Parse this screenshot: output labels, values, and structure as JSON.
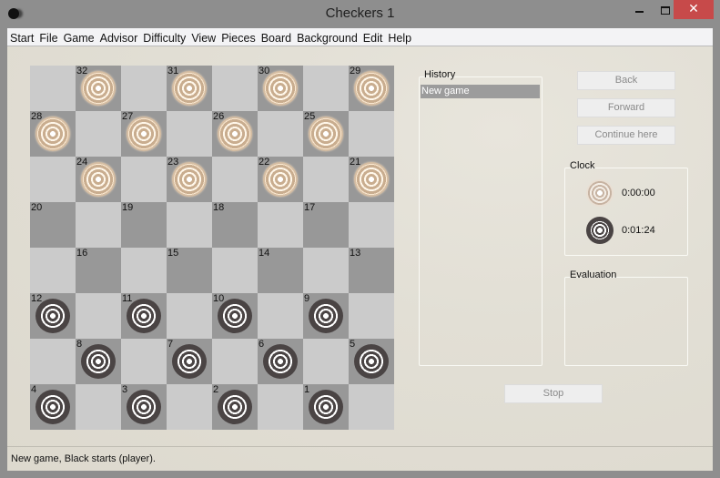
{
  "window": {
    "title": "Checkers 1",
    "close_glyph": "✕"
  },
  "menu": [
    "Start",
    "File",
    "Game",
    "Advisor",
    "Difficulty",
    "View",
    "Pieces",
    "Board",
    "Background",
    "Edit",
    "Help"
  ],
  "board": {
    "size": 8,
    "squares": [
      {
        "row": 0,
        "col": 1,
        "num": "32",
        "piece": "white"
      },
      {
        "row": 0,
        "col": 3,
        "num": "31",
        "piece": "white"
      },
      {
        "row": 0,
        "col": 5,
        "num": "30",
        "piece": "white"
      },
      {
        "row": 0,
        "col": 7,
        "num": "29",
        "piece": "white"
      },
      {
        "row": 1,
        "col": 0,
        "num": "28",
        "piece": "white"
      },
      {
        "row": 1,
        "col": 2,
        "num": "27",
        "piece": "white"
      },
      {
        "row": 1,
        "col": 4,
        "num": "26",
        "piece": "white"
      },
      {
        "row": 1,
        "col": 6,
        "num": "25",
        "piece": "white"
      },
      {
        "row": 2,
        "col": 1,
        "num": "24",
        "piece": "white"
      },
      {
        "row": 2,
        "col": 3,
        "num": "23",
        "piece": "white"
      },
      {
        "row": 2,
        "col": 5,
        "num": "22",
        "piece": "white"
      },
      {
        "row": 2,
        "col": 7,
        "num": "21",
        "piece": "white"
      },
      {
        "row": 3,
        "col": 0,
        "num": "20",
        "piece": null
      },
      {
        "row": 3,
        "col": 2,
        "num": "19",
        "piece": null
      },
      {
        "row": 3,
        "col": 4,
        "num": "18",
        "piece": null
      },
      {
        "row": 3,
        "col": 6,
        "num": "17",
        "piece": null
      },
      {
        "row": 4,
        "col": 1,
        "num": "16",
        "piece": null
      },
      {
        "row": 4,
        "col": 3,
        "num": "15",
        "piece": null
      },
      {
        "row": 4,
        "col": 5,
        "num": "14",
        "piece": null
      },
      {
        "row": 4,
        "col": 7,
        "num": "13",
        "piece": null
      },
      {
        "row": 5,
        "col": 0,
        "num": "12",
        "piece": "black"
      },
      {
        "row": 5,
        "col": 2,
        "num": "11",
        "piece": "black"
      },
      {
        "row": 5,
        "col": 4,
        "num": "10",
        "piece": "black"
      },
      {
        "row": 5,
        "col": 6,
        "num": "9",
        "piece": "black"
      },
      {
        "row": 6,
        "col": 1,
        "num": "8",
        "piece": "black"
      },
      {
        "row": 6,
        "col": 3,
        "num": "7",
        "piece": "black"
      },
      {
        "row": 6,
        "col": 5,
        "num": "6",
        "piece": "black"
      },
      {
        "row": 6,
        "col": 7,
        "num": "5",
        "piece": "black"
      },
      {
        "row": 7,
        "col": 0,
        "num": "4",
        "piece": "black"
      },
      {
        "row": 7,
        "col": 2,
        "num": "3",
        "piece": "black"
      },
      {
        "row": 7,
        "col": 4,
        "num": "2",
        "piece": "black"
      },
      {
        "row": 7,
        "col": 6,
        "num": "1",
        "piece": "black"
      }
    ]
  },
  "history": {
    "label": "History",
    "items": [
      "New game"
    ]
  },
  "buttons": {
    "back": "Back",
    "forward": "Forward",
    "continue": "Continue here",
    "stop": "Stop"
  },
  "clock": {
    "label": "Clock",
    "white_time": "0:00:00",
    "black_time": "0:01:24"
  },
  "evaluation": {
    "label": "Evaluation"
  },
  "status": "New game, Black starts (player)."
}
